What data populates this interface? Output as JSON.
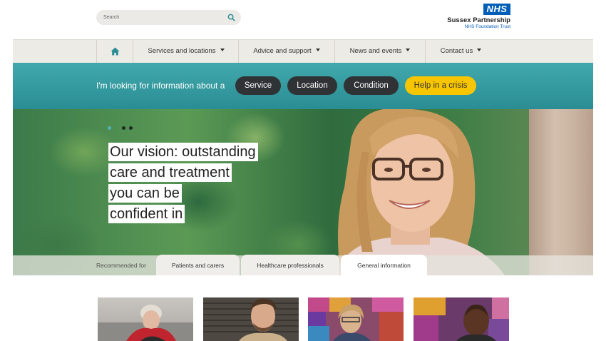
{
  "search": {
    "placeholder": "Search",
    "icon": "search-icon"
  },
  "logo": {
    "nhs": "NHS",
    "org": "Sussex Partnership",
    "trust": "NHS Foundation Trust",
    "color": "#005eb8"
  },
  "nav": {
    "home_icon": "home-icon",
    "items": [
      {
        "label": "Services and locations"
      },
      {
        "label": "Advice and support"
      },
      {
        "label": "News and events"
      },
      {
        "label": "Contact us"
      }
    ]
  },
  "finder": {
    "lead": "I'm looking for information about a",
    "buttons": [
      {
        "label": "Service"
      },
      {
        "label": "Location"
      },
      {
        "label": "Condition"
      },
      {
        "label": "Help in a crisis"
      }
    ],
    "colors": {
      "bar": "#2f979c",
      "pill": "#2f3335",
      "crisis": "#f7c600"
    }
  },
  "hero": {
    "headline_lines": [
      "Our vision: outstanding",
      "care and treatment",
      "you can be",
      "confident in"
    ],
    "slides": {
      "count": 3,
      "active": 1
    }
  },
  "recommended": {
    "label": "Recommended for",
    "tabs": [
      {
        "label": "Patients and carers"
      },
      {
        "label": "Healthcare professionals"
      },
      {
        "label": "General information",
        "active": true
      }
    ]
  }
}
